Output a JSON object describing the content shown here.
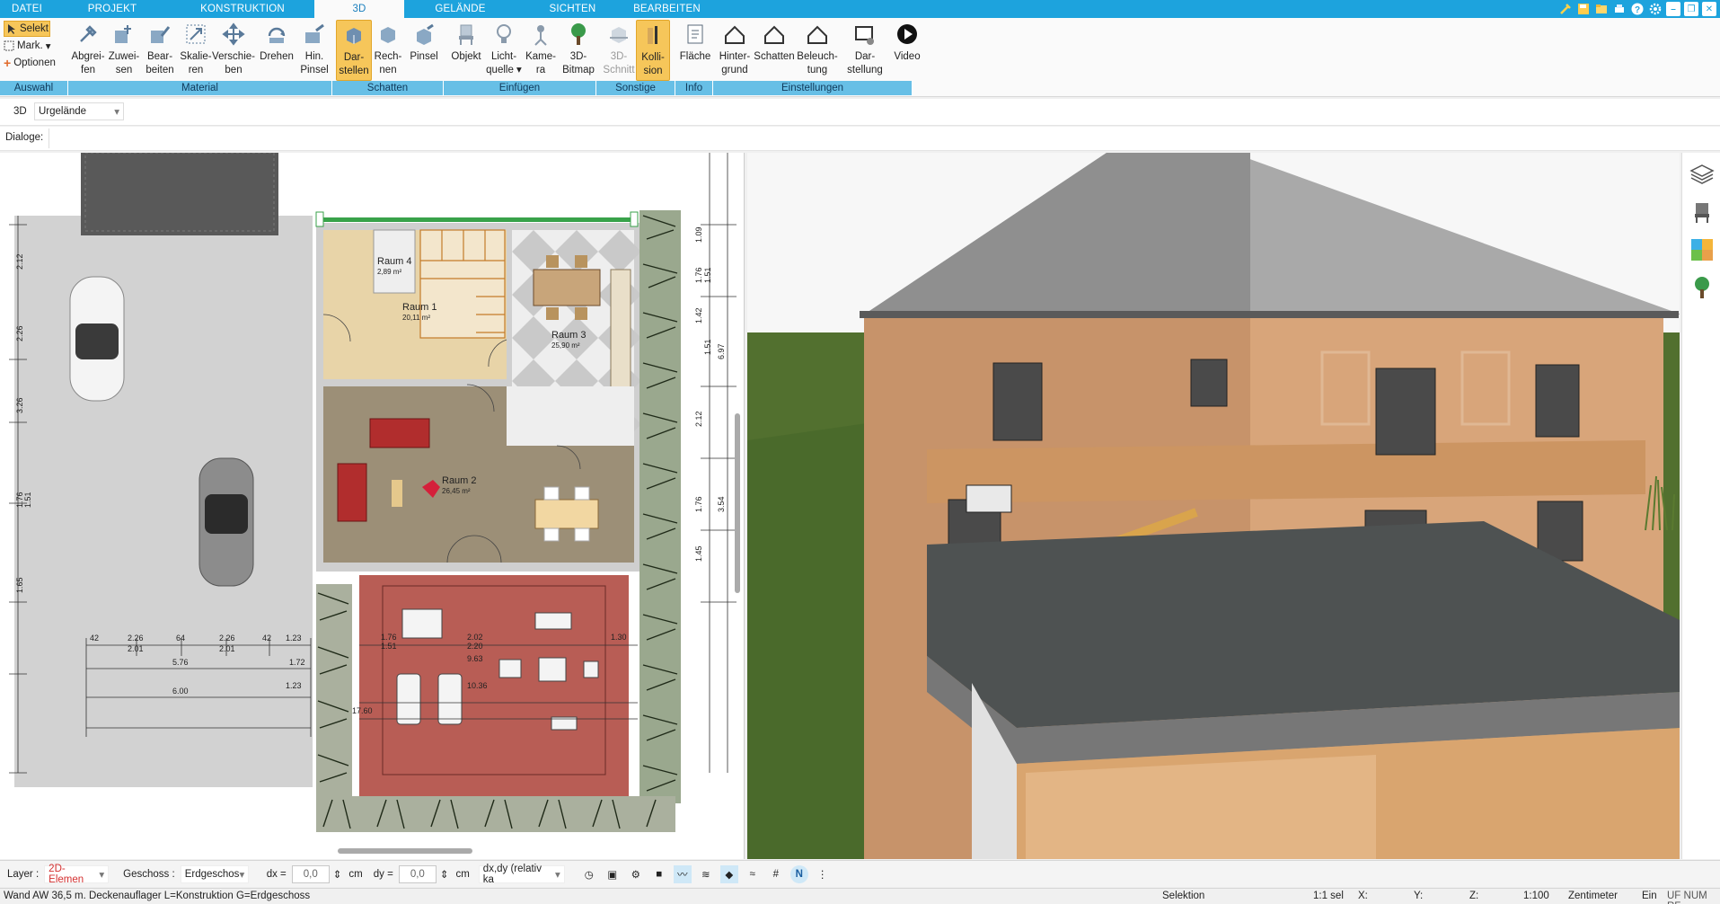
{
  "tabs": [
    {
      "label": "DATEI",
      "active": false
    },
    {
      "label": "PROJEKT",
      "active": false
    },
    {
      "label": "KONSTRUKTION",
      "active": false
    },
    {
      "label": "3D",
      "active": true
    },
    {
      "label": "GELÄNDE",
      "active": false
    },
    {
      "label": "SICHTEN",
      "active": false
    },
    {
      "label": "BEARBEITEN",
      "active": false
    }
  ],
  "ribbon": {
    "select_label": "Selekt",
    "mark_label": "Mark.",
    "options_label": "Optionen",
    "buttons": [
      {
        "l1": "Abgrei-",
        "l2": "fen",
        "icon": "eyedropper-icon"
      },
      {
        "l1": "Zuwei-",
        "l2": "sen",
        "icon": "assign-material-icon"
      },
      {
        "l1": "Bear-",
        "l2": "beiten",
        "icon": "edit-material-icon"
      },
      {
        "l1": "Skalie-",
        "l2": "ren",
        "icon": "scale-icon"
      },
      {
        "l1": "Verschie-",
        "l2": "ben",
        "icon": "move-icon"
      },
      {
        "l1": "Drehen",
        "l2": "",
        "icon": "rotate-icon"
      },
      {
        "l1": "Hin.",
        "l2": "Pinsel",
        "icon": "paint-brush-icon"
      },
      {
        "l1": "Dar-",
        "l2": "stellen",
        "icon": "shadow-display-icon",
        "active": true
      },
      {
        "l1": "Rech-",
        "l2": "nen",
        "icon": "calculate-icon"
      },
      {
        "l1": "Pinsel",
        "l2": "",
        "icon": "shadow-brush-icon"
      },
      {
        "l1": "Objekt",
        "l2": "",
        "icon": "chair-icon"
      },
      {
        "l1": "Licht-",
        "l2": "quelle",
        "icon": "light-bulb-icon",
        "dropdown": true
      },
      {
        "l1": "Kame-",
        "l2": "ra",
        "icon": "camera-icon"
      },
      {
        "l1": "3D-",
        "l2": "Bitmap",
        "icon": "tree-icon"
      },
      {
        "l1": "3D-",
        "l2": "Schnitt",
        "icon": "section-icon",
        "dim": true
      },
      {
        "l1": "Kolli-",
        "l2": "sion",
        "icon": "collision-icon",
        "active": true
      },
      {
        "l1": "Fläche",
        "l2": "",
        "icon": "area-info-icon"
      },
      {
        "l1": "Hinter-",
        "l2": "grund",
        "icon": "background-icon"
      },
      {
        "l1": "Schatten",
        "l2": "",
        "icon": "shadow-settings-icon"
      },
      {
        "l1": "Beleuch-",
        "l2": "tung",
        "icon": "lighting-icon"
      },
      {
        "l1": "Dar-",
        "l2": "stellung",
        "icon": "display-settings-icon"
      },
      {
        "l1": "Video",
        "l2": "",
        "icon": "play-icon"
      }
    ],
    "groups": [
      "Auswahl",
      "Material",
      "Schatten",
      "Einfügen",
      "Sonstige",
      "Info",
      "Einstellungen"
    ]
  },
  "viewbar": {
    "mode": "3D",
    "terrain": "Urgelände"
  },
  "dialogbar": {
    "label": "Dialoge:"
  },
  "plan": {
    "rooms": [
      {
        "name": "Raum 4",
        "area": "2,89 m²"
      },
      {
        "name": "Raum 1",
        "area": "20,11 m²"
      },
      {
        "name": "Raum 3",
        "area": "25,90 m²"
      },
      {
        "name": "Raum 2",
        "area": "26,45 m²"
      }
    ],
    "dims_left": [
      "2.12",
      "2.26",
      "3.26",
      "1.76",
      "1.51",
      "1.65"
    ],
    "dims_right": [
      "1.09",
      "1.51",
      "1.76",
      "1.51",
      "1.42",
      "2.12",
      "1.76",
      "1.45",
      "6.97",
      "3.54"
    ],
    "dims_bottom": [
      {
        "a": "42",
        "b": ""
      },
      {
        "a": "2.26",
        "b": "2.01"
      },
      {
        "a": "64",
        "b": ""
      },
      {
        "a": "2.26",
        "b": "2.01"
      },
      {
        "a": "42",
        "b": ""
      },
      {
        "a": "1.23",
        "b": ""
      }
    ],
    "dim_576": "5.76",
    "dim_172": "1.72",
    "dim_600": "6.00",
    "dim_123b": "1.23",
    "dim_1760": "17.60",
    "terrace_dims": [
      "1.76",
      "1.51",
      "2.02",
      "2.20",
      "1.30",
      "9.63",
      "10.36"
    ]
  },
  "optbar": {
    "layer_label": "Layer :",
    "layer_value": "2D-Elemen",
    "floor_label": "Geschoss :",
    "floor_value": "Erdgeschos",
    "dx_label": "dx =",
    "dx_value": "0,0",
    "dx_unit": "cm",
    "dy_label": "dy =",
    "dy_value": "0,0",
    "dy_unit": "cm",
    "coord_mode": "dx,dy (relativ ka"
  },
  "status": {
    "message": "Wand AW 36,5 m. Deckenauflager L=Konstruktion G=Erdgeschoss",
    "mode": "Selektion",
    "selcount": "1:1 sel",
    "x": "X:",
    "y": "Y:",
    "z": "Z:",
    "scale": "1:100",
    "unit": "Zentimeter",
    "ein": "Ein",
    "flags": "UF NUM RF"
  },
  "colors": {
    "accent": "#1da3dd",
    "group_bar": "#67bfe6",
    "active_button": "#f6c65a",
    "terrace": "#b85d55"
  }
}
